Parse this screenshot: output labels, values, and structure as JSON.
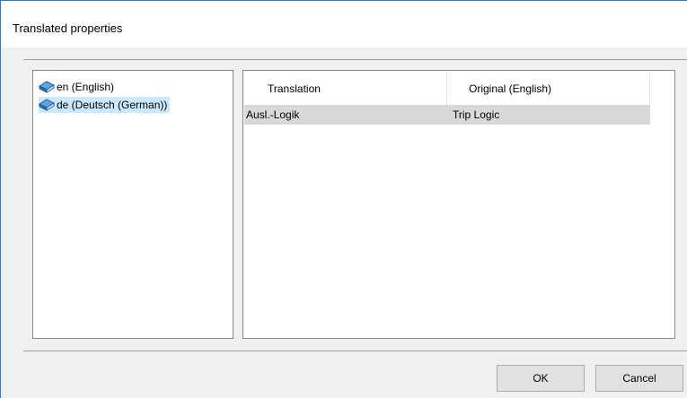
{
  "window": {
    "title": "Translated properties"
  },
  "languages": [
    {
      "label": "en (English)",
      "icon": "book-icon",
      "selected": false
    },
    {
      "label": "de (Deutsch (German))",
      "icon": "book-icon",
      "selected": true
    }
  ],
  "grid": {
    "columns": [
      "Translation",
      "Original (English)"
    ],
    "rows": [
      [
        "Ausl.-Logik",
        "Trip Logic"
      ]
    ]
  },
  "buttons": {
    "ok": "OK",
    "cancel": "Cancel"
  },
  "colors": {
    "selection": "#cce8ff",
    "row_highlight": "#d9d9d9",
    "accent": "#2b79d8"
  }
}
